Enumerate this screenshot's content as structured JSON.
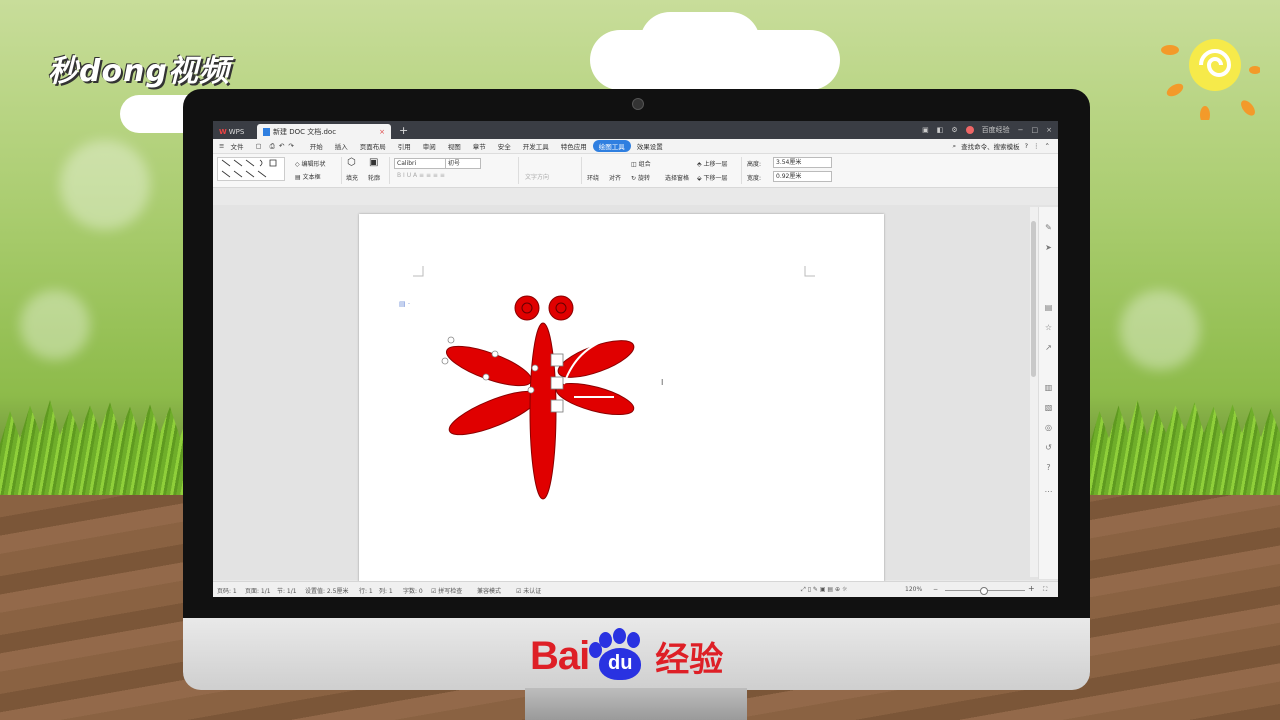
{
  "brand": {
    "top_logo": "秒dong视频",
    "baidu_bai": "Bai",
    "baidu_du": "du",
    "baidu_jingyan": "经验"
  },
  "app": {
    "wps_tab": "WPS",
    "doc_tab": "新建 DOC 文档.doc",
    "new_tab": "+",
    "user": "百度经验"
  },
  "menu": {
    "file": "文件",
    "items": [
      "开始",
      "插入",
      "页面布局",
      "引用",
      "审阅",
      "视图",
      "章节",
      "安全",
      "开发工具",
      "特色应用",
      "绘图工具",
      "效果设置"
    ],
    "active": "绘图工具",
    "search": "查找命令、搜索模板"
  },
  "ribbon": {
    "edit_shape": "编辑形状",
    "text_box": "文本框",
    "fill": "填充",
    "outline": "轮廓",
    "font": "Calibri",
    "size": "初号",
    "text_dir": "文字方向",
    "wrap": "环绕",
    "align": "对齐",
    "group": "组合",
    "rotate": "旋转",
    "select_pane": "选择窗格",
    "bring_up": "上移一层",
    "send_down": "下移一层",
    "height_label": "高度:",
    "height_value": "3.54厘米",
    "width_label": "宽度:",
    "width_value": "0.92厘米"
  },
  "status": {
    "page": "页码: 1",
    "pages": "页面: 1/1",
    "section": "节: 1/1",
    "setting": "设置值: 2.5厘米",
    "row": "行: 1",
    "col": "列: 1",
    "words": "字数: 0",
    "spell": "拼写检查",
    "compat": "兼容模式",
    "cert": "未认证",
    "zoom": "120%"
  },
  "colors": {
    "dragonfly": "#e00000",
    "accent": "#2f7fe0"
  }
}
